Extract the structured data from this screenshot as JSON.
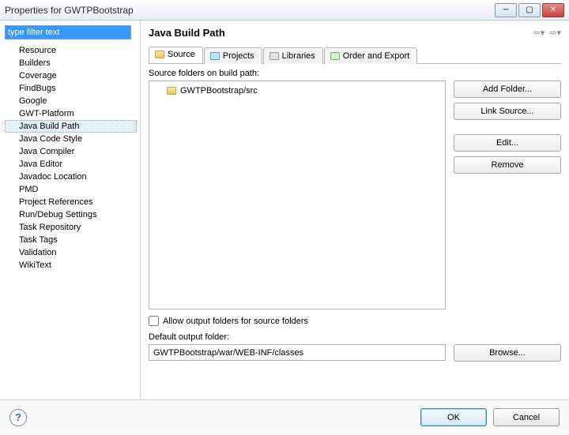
{
  "window": {
    "title": "Properties for GWTPBootstrap"
  },
  "sidebar": {
    "filter_value": "type filter text",
    "items": [
      "Resource",
      "Builders",
      "Coverage",
      "FindBugs",
      "Google",
      "GWT-Platform",
      "Java Build Path",
      "Java Code Style",
      "Java Compiler",
      "Java Editor",
      "Javadoc Location",
      "PMD",
      "Project References",
      "Run/Debug Settings",
      "Task Repository",
      "Task Tags",
      "Validation",
      "WikiText"
    ],
    "selected_index": 6
  },
  "page": {
    "title": "Java Build Path"
  },
  "tabs": {
    "items": [
      "Source",
      "Projects",
      "Libraries",
      "Order and Export"
    ],
    "active_index": 0
  },
  "source": {
    "label": "Source folders on build path:",
    "folders": [
      "GWTPBootstrap/src"
    ],
    "buttons": {
      "add": "Add Folder...",
      "link": "Link Source...",
      "edit": "Edit...",
      "remove": "Remove"
    },
    "allow_output_label": "Allow output folders for source folders",
    "allow_output_checked": false,
    "default_output_label": "Default output folder:",
    "default_output_value": "GWTPBootstrap/war/WEB-INF/classes",
    "browse": "Browse..."
  },
  "footer": {
    "ok": "OK",
    "cancel": "Cancel"
  }
}
